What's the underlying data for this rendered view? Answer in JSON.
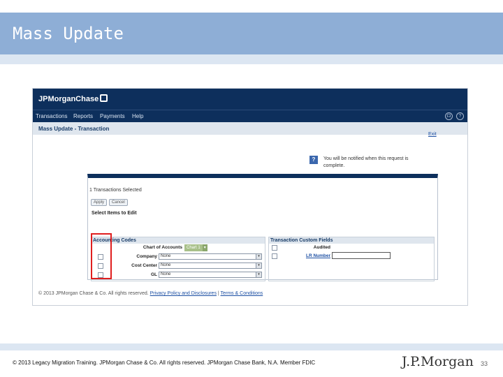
{
  "slide": {
    "title": "Mass Update",
    "footer": "© 2013 Legacy Migration Training. JPMorgan Chase & Co. All rights reserved. JPMorgan Chase Bank, N.A. Member FDIC",
    "logo": "J.P.Morgan",
    "page_number": "33"
  },
  "app": {
    "brand": "JPMorganChase",
    "nav": [
      "Transactions",
      "Reports",
      "Payments",
      "Help"
    ],
    "page_title": "Mass Update - Transaction",
    "exit_link": "Exit",
    "notice": "You will be notified when this request is complete.",
    "selection_text": "1 Transactions Selected",
    "buttons": {
      "apply": "Apply",
      "cancel": "Cancel"
    },
    "select_items_label": "Select Items to Edit",
    "accounting": {
      "header": "Accounting Codes",
      "chart_label": "Chart of Accounts",
      "chart_value": "Chart 1",
      "rows": [
        {
          "label": "Company",
          "value": "None"
        },
        {
          "label": "Cost Center",
          "value": "None"
        },
        {
          "label": "GL",
          "value": "None"
        }
      ]
    },
    "custom_fields": {
      "header": "Transaction Custom Fields",
      "audited_label": "Audited",
      "lr_number_label": "LR Number"
    },
    "footer": {
      "copyright": "© 2013 JPMorgan Chase & Co. All rights reserved.",
      "privacy": "Privacy Policy and Disclosures",
      "terms": "Terms & Conditions"
    }
  },
  "colors": {
    "title_bar": "#8eaed6",
    "app_navy": "#0d2f5c",
    "highlight": "#e01e1e"
  }
}
